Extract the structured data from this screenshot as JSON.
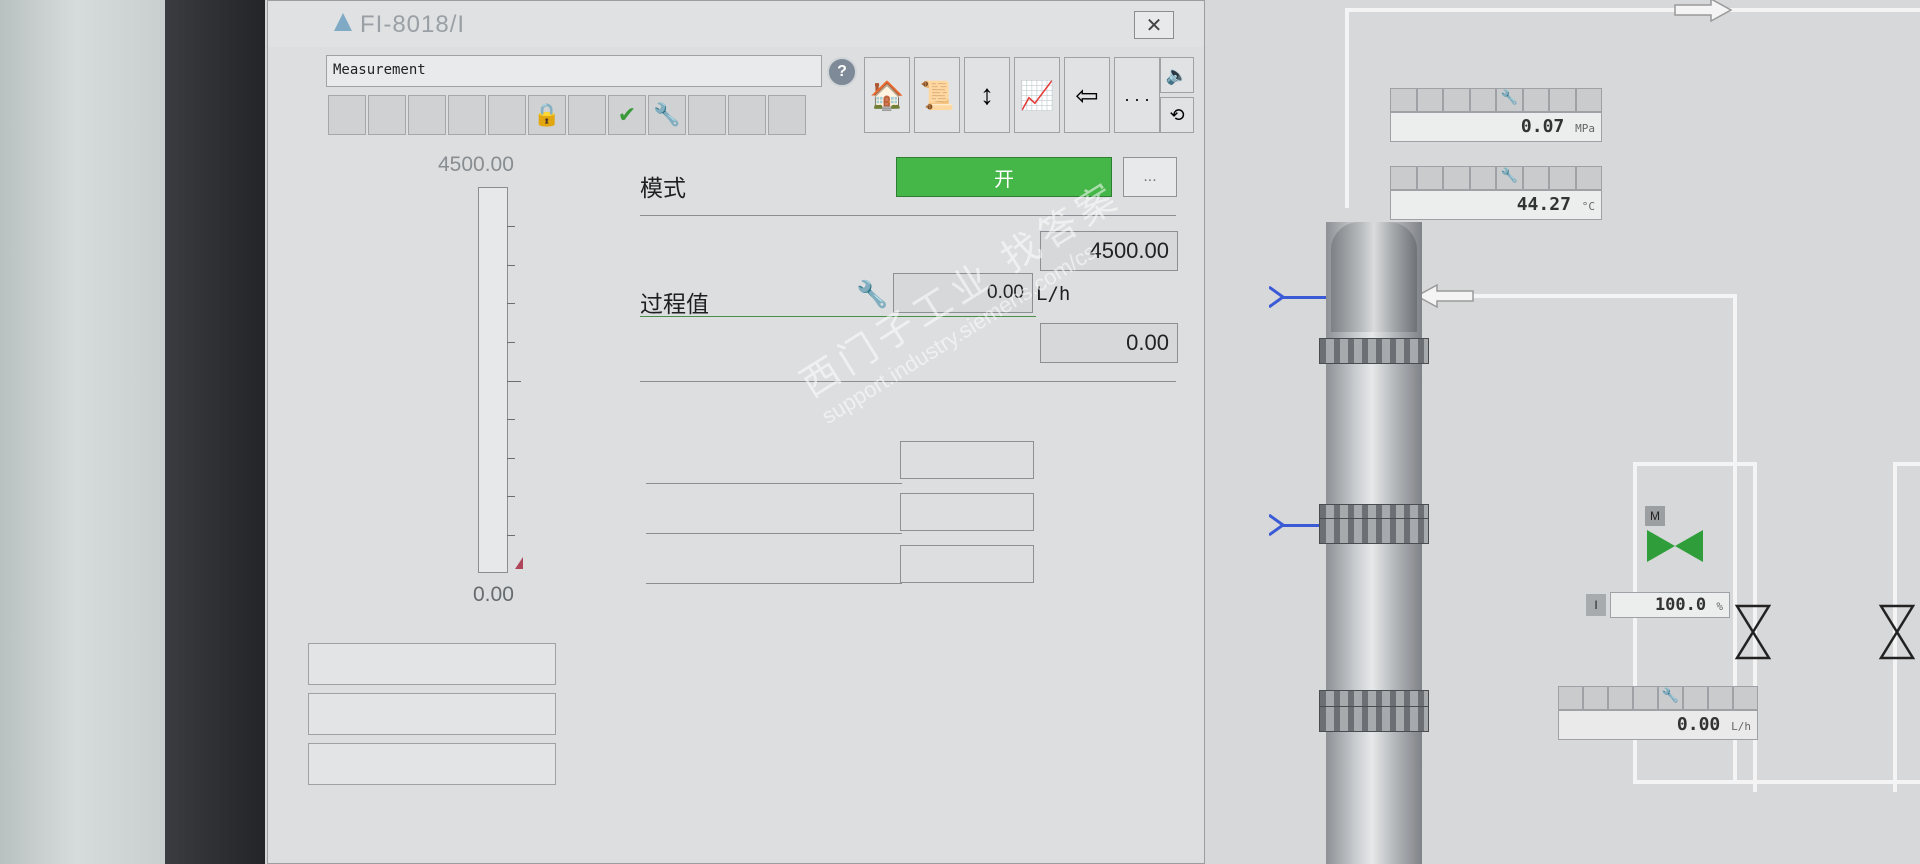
{
  "window": {
    "title": "FI-8018/I",
    "close_label": "✕",
    "name_field": "Measurement",
    "help_label": "?"
  },
  "toolbar": {
    "status_icons": [
      "",
      "",
      "",
      "",
      "",
      "lock-icon",
      "",
      "check-icon",
      "wrench-icon",
      "",
      "",
      ""
    ],
    "view_buttons": [
      "home-icon",
      "batch-icon",
      "limits-icon",
      "trend-icon",
      "ack-icon",
      "more-icon"
    ],
    "more_label": ". . ."
  },
  "bar": {
    "max_label": "4500.00",
    "min_label": "0.00",
    "fill_fraction": 0.0
  },
  "params": {
    "mode_label": "模式",
    "mode_value": "开",
    "mode_more": "...",
    "high_limit": "4500.00",
    "pv_label": "过程值",
    "pv_value": "0.00",
    "pv_unit": "L/h",
    "low_limit": "0.00"
  },
  "watermark": {
    "line1": "西门子工业  找答案",
    "line2": "support.industry.siemens.com/cs"
  },
  "process": {
    "pressure_value": "0.07",
    "pressure_unit": "MPa",
    "temp_value": "44.27",
    "temp_unit": "°C",
    "valve_mode": "M",
    "valve_pos_label": "I",
    "valve_position": "100.0",
    "valve_pos_unit": "%",
    "flow_value": "0.00",
    "flow_unit": "L/h"
  },
  "colors": {
    "mode_on": "#45b648",
    "valve_open": "#2f9e3a",
    "pipe_blue": "#3b5bd6"
  }
}
